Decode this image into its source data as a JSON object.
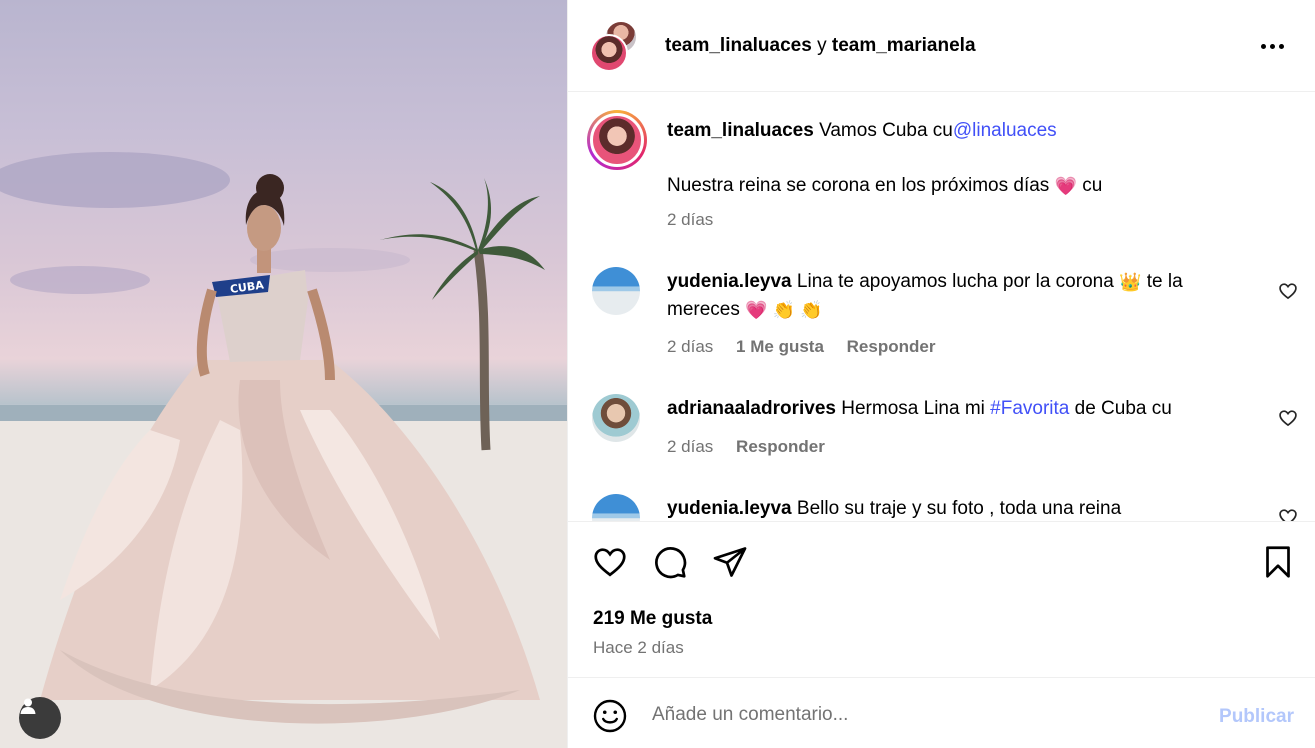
{
  "post": {
    "sash_text": "CUBA"
  },
  "header": {
    "author1": "team_linaluaces",
    "separator": "y",
    "author2": "team_marianela",
    "more_icon": "more-horizontal-icon"
  },
  "caption": {
    "username": "team_linaluaces",
    "text": "Vamos Cuba cu",
    "mention": "@linaluaces",
    "line2": "Nuestra reina se corona en los próximos días",
    "line2_emoji": "💗",
    "line2_suffix": "cu",
    "time": "2 días"
  },
  "comments": [
    {
      "username": "yudenia.leyva",
      "text_a": "Lina te apoyamos lucha por la corona",
      "emoji_a": "👑",
      "text_b": "te la",
      "text_c": "mereces",
      "emojis_c": "💗 👏 👏",
      "time": "2 días",
      "likes": "1 Me gusta",
      "reply": "Responder"
    },
    {
      "username": "adrianaaladrorives",
      "text_a": "Hermosa Lina mi",
      "hashtag": "#Favorita",
      "text_b": "de Cuba cu",
      "time": "2 días",
      "reply": "Responder"
    },
    {
      "username": "yudenia.leyva",
      "text_a": "Bello su traje y su foto , toda una reina"
    }
  ],
  "actions": {
    "likes": "219 Me gusta",
    "time_ago": "Hace 2 días"
  },
  "compose": {
    "placeholder": "Añade un comentario...",
    "publish_label": "Publicar"
  },
  "colors": {
    "link": "#4150f7",
    "publish_disabled": "#b3c7fb",
    "secondary_text": "#737373"
  }
}
